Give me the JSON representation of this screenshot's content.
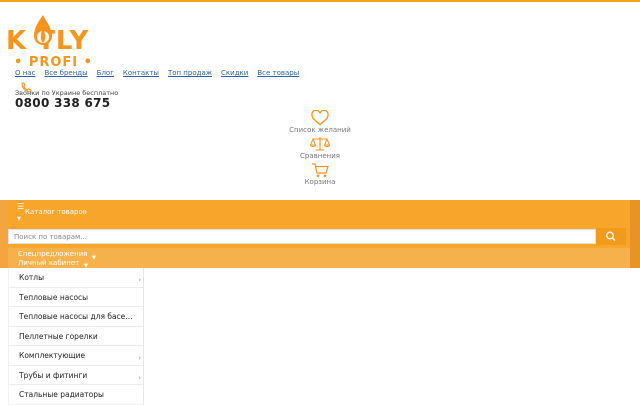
{
  "logo": {
    "word": "K   TLY",
    "sub": "• PROFI •"
  },
  "nav": [
    {
      "label": "О нас"
    },
    {
      "label": "Все бренды"
    },
    {
      "label": "Блог"
    },
    {
      "label": "Контакты"
    },
    {
      "label": "Топ продаж"
    },
    {
      "label": "Скидки"
    },
    {
      "label": "Все товары"
    }
  ],
  "phone": {
    "label": "Звонки по Украине бесплатно",
    "number": "0800 338 675"
  },
  "tools": {
    "wishlist": "Список желаний",
    "compare": "Сравнения",
    "cart": "Корзина"
  },
  "catalog": {
    "label": "Каталог товаров"
  },
  "search": {
    "placeholder": "Поиск по товарам..."
  },
  "lowerbar": {
    "special": "Спецпредложения",
    "cabinet": "Личный кабинет"
  },
  "menu": {
    "items": [
      {
        "label": "Котлы",
        "arrow": "›"
      },
      {
        "label": "Тепловые насосы",
        "arrow": ""
      },
      {
        "label": "Тепловые насосы для басей...",
        "arrow": ""
      },
      {
        "label": "Пеллетные горелки",
        "arrow": ""
      },
      {
        "label": "Комплектующие",
        "arrow": "›"
      },
      {
        "label": "Трубы и фитинги",
        "arrow": "›"
      },
      {
        "label": "Стальные радиаторы",
        "arrow": ""
      }
    ]
  },
  "colors": {
    "brand": "#f7941d",
    "bar": "#f7a52b",
    "link": "#2d62a8"
  }
}
